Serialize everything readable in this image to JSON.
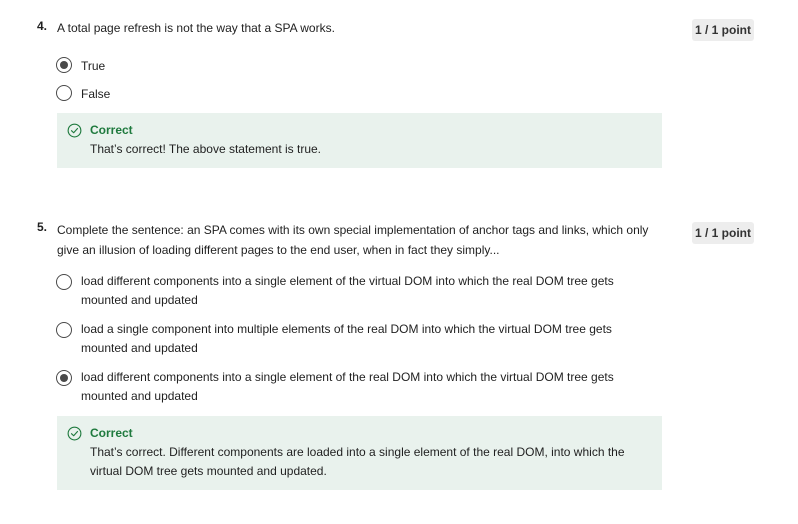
{
  "questions": [
    {
      "number": "4.",
      "text": "A total page refresh is not the way that a SPA works.",
      "points": "1 / 1 point",
      "options": [
        {
          "label": "True",
          "selected": true
        },
        {
          "label": "False",
          "selected": false
        }
      ],
      "feedback": {
        "title": "Correct",
        "text": "That’s correct! The above statement is true."
      }
    },
    {
      "number": "5.",
      "text": "Complete the sentence: an SPA comes with its own special implementation of anchor tags and links, which only give an illusion of loading different pages to the end user, when in fact they simply...",
      "points": "1 / 1 point",
      "options": [
        {
          "label": "load different components into a single element of the virtual DOM into which the real DOM tree gets mounted and updated",
          "selected": false
        },
        {
          "label": "load a single component into multiple elements of the real DOM into which the virtual DOM tree gets mounted and updated",
          "selected": false
        },
        {
          "label": "load different components into a single element of the real DOM into which the virtual DOM tree gets mounted and updated",
          "selected": true
        }
      ],
      "feedback": {
        "title": "Correct",
        "text": "That’s correct. Different components are loaded into a single element of the real DOM, into which the virtual DOM tree gets mounted and updated."
      }
    }
  ],
  "colors": {
    "feedback_bg": "#e9f2ed",
    "correct_green": "#1f7a3e",
    "points_bg": "#ededed"
  },
  "icons": {
    "correct": "check-circle-icon",
    "radio": "radio-button"
  }
}
